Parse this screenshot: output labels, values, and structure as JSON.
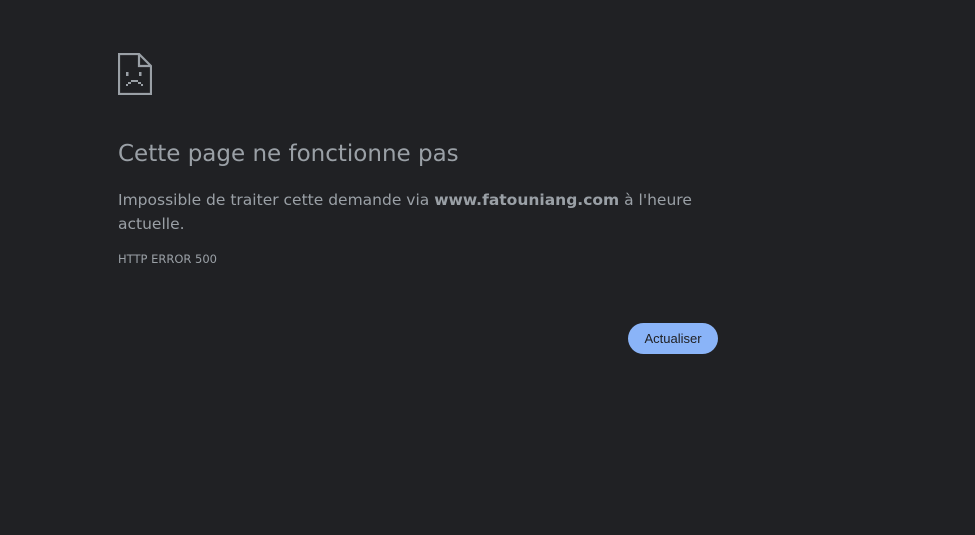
{
  "error": {
    "icon": "sad-page-icon",
    "title": "Cette page ne fonctionne pas",
    "desc_prefix": "Impossible de traiter cette demande via ",
    "domain": "www.fatouniang.com",
    "desc_suffix": " à l'heure actuelle.",
    "code": "HTTP ERROR 500"
  },
  "actions": {
    "reload_label": "Actualiser"
  },
  "colors": {
    "background": "#202124",
    "text": "#9aa0a6",
    "button": "#8ab4f8",
    "button_text": "#202124"
  }
}
